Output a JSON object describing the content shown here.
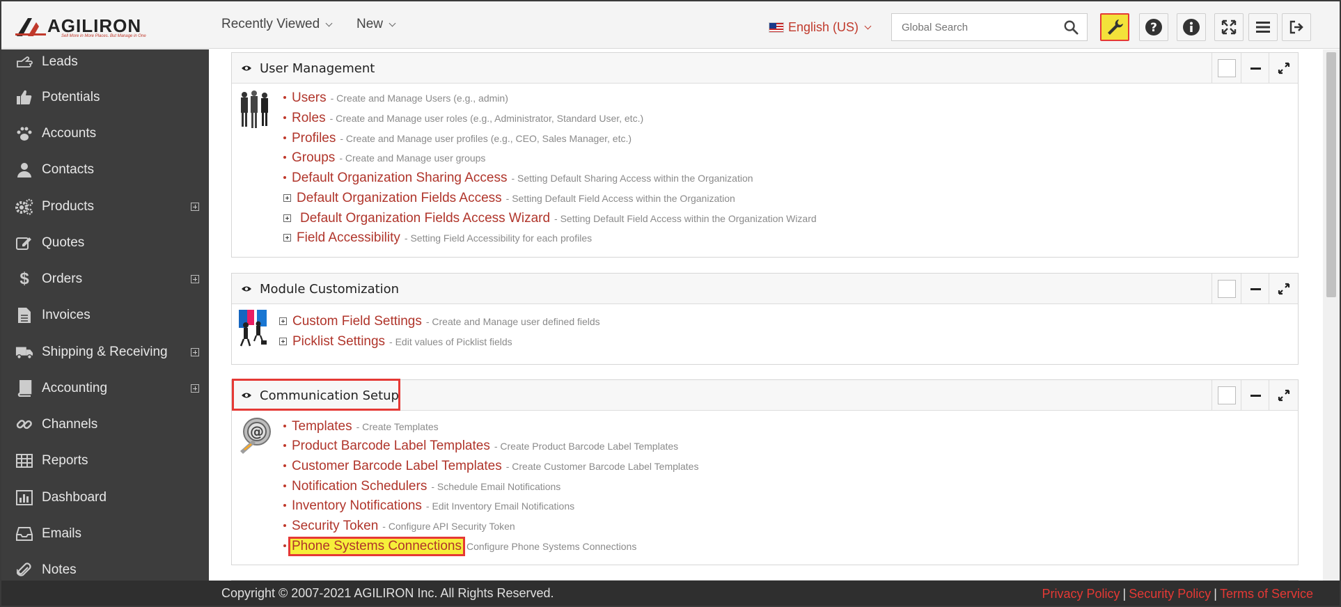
{
  "header": {
    "logo_text": "AGILIRON",
    "logo_tagline": "Sell More in More Places. But Manage in One",
    "nav": [
      {
        "label": "Recently Viewed"
      },
      {
        "label": "New"
      }
    ],
    "language": "English (US)",
    "search_placeholder": "Global Search",
    "toolbar_icons": [
      "wrench-icon",
      "help-icon",
      "info-icon",
      "fullscreen-icon",
      "menu-icon",
      "logout-icon"
    ]
  },
  "sidebar": {
    "items": [
      {
        "label": "Leads",
        "icon": "hand-point-icon",
        "expandable": false
      },
      {
        "label": "Potentials",
        "icon": "thumbs-up-icon",
        "expandable": false
      },
      {
        "label": "Accounts",
        "icon": "paw-icon",
        "expandable": false
      },
      {
        "label": "Contacts",
        "icon": "user-icon",
        "expandable": false
      },
      {
        "label": "Products",
        "icon": "gears-icon",
        "expandable": true
      },
      {
        "label": "Quotes",
        "icon": "edit-icon",
        "expandable": false
      },
      {
        "label": "Orders",
        "icon": "dollar-icon",
        "expandable": true
      },
      {
        "label": "Invoices",
        "icon": "file-icon",
        "expandable": false
      },
      {
        "label": "Shipping & Receiving",
        "icon": "truck-icon",
        "expandable": true
      },
      {
        "label": "Accounting",
        "icon": "book-icon",
        "expandable": true
      },
      {
        "label": "Channels",
        "icon": "link-icon",
        "expandable": false
      },
      {
        "label": "Reports",
        "icon": "table-icon",
        "expandable": false
      },
      {
        "label": "Dashboard",
        "icon": "bar-chart-icon",
        "expandable": false
      },
      {
        "label": "Emails",
        "icon": "inbox-icon",
        "expandable": false
      },
      {
        "label": "Notes",
        "icon": "paperclip-icon",
        "expandable": false
      }
    ]
  },
  "panels": {
    "user_management": {
      "title": "User Management",
      "items": [
        {
          "link": "Users",
          "desc": "- Create and Manage Users (e.g., admin)"
        },
        {
          "link": "Roles",
          "desc": "- Create and Manage user roles (e.g., Administrator, Standard User, etc.)"
        },
        {
          "link": "Profiles",
          "desc": "- Create and Manage user profiles (e.g., CEO, Sales Manager, etc.)"
        },
        {
          "link": "Groups",
          "desc": "- Create and Manage user groups"
        },
        {
          "link": "Default Organization Sharing Access",
          "desc": "- Setting Default Sharing Access within the Organization"
        },
        {
          "link": "Default Organization Fields Access",
          "desc": "- Setting Default Field Access within the Organization"
        },
        {
          "link": "Default Organization Fields Access Wizard",
          "desc": "- Setting Default Field Access within the Organization Wizard"
        },
        {
          "link": "Field Accessibility",
          "desc": "- Setting Field Accessibility for each profiles"
        }
      ]
    },
    "module_customization": {
      "title": "Module Customization",
      "items": [
        {
          "link": "Custom Field Settings",
          "desc": "- Create and Manage user defined fields"
        },
        {
          "link": "Picklist Settings",
          "desc": "- Edit values of Picklist fields"
        }
      ]
    },
    "communication_setup": {
      "title": "Communication Setup",
      "items": [
        {
          "link": "Templates",
          "desc": "- Create Templates"
        },
        {
          "link": "Product Barcode Label Templates",
          "desc": "- Create Product Barcode Label Templates"
        },
        {
          "link": "Customer Barcode Label Templates",
          "desc": "- Create Customer Barcode Label Templates"
        },
        {
          "link": "Notification Schedulers",
          "desc": "- Schedule Email Notifications"
        },
        {
          "link": "Inventory Notifications",
          "desc": "- Edit Inventory Email Notifications"
        },
        {
          "link": "Security Token",
          "desc": "- Configure API Security Token"
        },
        {
          "link": "Phone Systems Connections",
          "desc": "Configure Phone Systems Connections"
        }
      ]
    }
  },
  "footer": {
    "copyright": "Copyright © 2007-2021 AGILIRON Inc. All Rights Reserved.",
    "links": [
      "Privacy Policy",
      "Security Policy",
      "Terms of Service"
    ],
    "separator": "|"
  },
  "colors": {
    "accent_red": "#c0392b",
    "highlight_yellow": "#f6ef3a",
    "highlight_border": "#e53935",
    "sidebar_bg": "#3d3d3d"
  }
}
